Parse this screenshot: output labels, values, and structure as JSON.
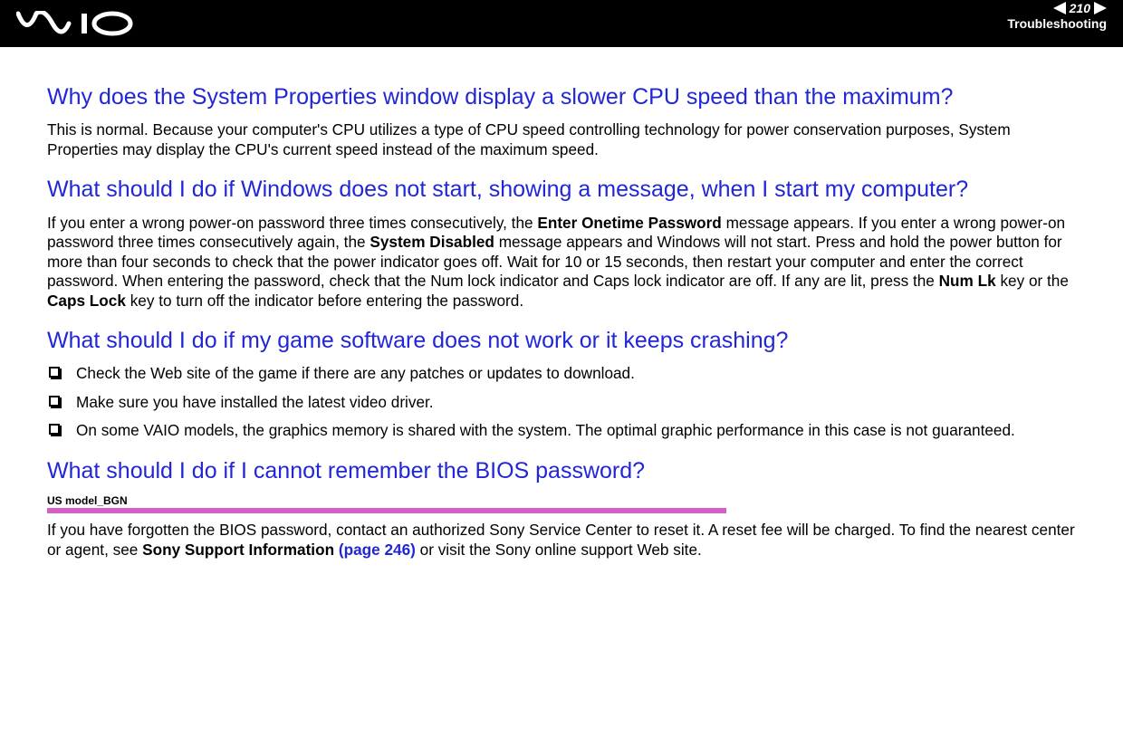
{
  "header": {
    "page_number": "210",
    "section": "Troubleshooting"
  },
  "sections": [
    {
      "heading": "Why does the System Properties window display a slower CPU speed than the maximum?",
      "paragraphs": [
        {
          "runs": [
            {
              "t": "This is normal. Because your computer's CPU utilizes a type of CPU speed controlling technology for power conservation purposes, System Properties may display the CPU's current speed instead of the maximum speed."
            }
          ]
        }
      ]
    },
    {
      "heading": "What should I do if Windows does not start, showing a message, when I start my computer?",
      "paragraphs": [
        {
          "runs": [
            {
              "t": "If you enter a wrong power-on password three times consecutively, the "
            },
            {
              "t": "Enter Onetime Password",
              "b": true
            },
            {
              "t": " message appears. If you enter a wrong power-on password three times consecutively again, the "
            },
            {
              "t": "System Disabled",
              "b": true
            },
            {
              "t": " message appears and Windows will not start. Press and hold the power button for more than four seconds to check that the power indicator goes off. Wait for 10 or 15 seconds, then restart your computer and enter the correct password. When entering the password, check that the Num lock indicator and Caps lock indicator are off. If any are lit, press the "
            },
            {
              "t": "Num Lk",
              "b": true
            },
            {
              "t": " key or the "
            },
            {
              "t": "Caps Lock",
              "b": true
            },
            {
              "t": " key to turn off the indicator before entering the password."
            }
          ]
        }
      ]
    },
    {
      "heading": "What should I do if my game software does not work or it keeps crashing?",
      "bullets": [
        {
          "runs": [
            {
              "t": "Check the Web site of the game if there are any patches or updates to download."
            }
          ]
        },
        {
          "runs": [
            {
              "t": "Make sure you have installed the latest video driver."
            }
          ]
        },
        {
          "runs": [
            {
              "t": "On some VAIO models, the graphics memory is shared with the system. The optimal graphic performance in this case is not guaranteed."
            }
          ]
        }
      ]
    },
    {
      "heading": "What should I do if I cannot remember the BIOS password?",
      "model_label": "US model_BGN",
      "paragraphs": [
        {
          "runs": [
            {
              "t": "If you have forgotten the BIOS password, contact an authorized Sony Service Center to reset it. A reset fee will be charged. To find the nearest center or agent, see "
            },
            {
              "t": "Sony Support Information ",
              "b": true
            },
            {
              "t": "(page 246)",
              "b": true,
              "link": true
            },
            {
              "t": " or visit the Sony online support Web site."
            }
          ]
        }
      ]
    }
  ]
}
